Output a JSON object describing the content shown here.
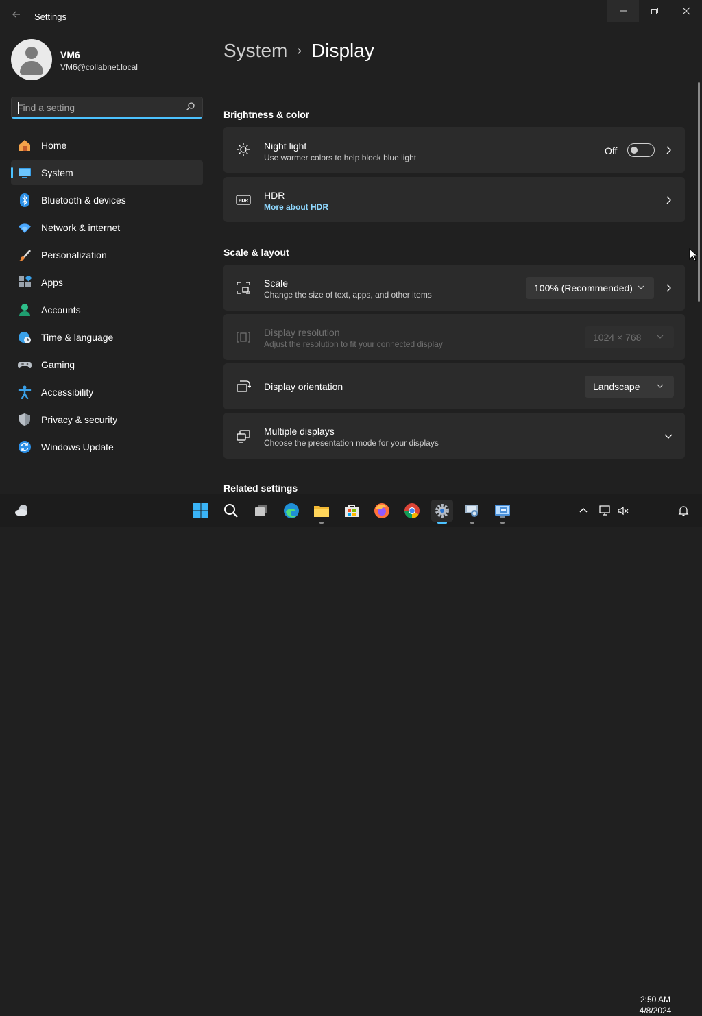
{
  "window": {
    "title": "Settings"
  },
  "user": {
    "name": "VM6",
    "email": "VM6@collabnet.local"
  },
  "search": {
    "placeholder": "Find a setting"
  },
  "sidebar": {
    "items": [
      {
        "label": "Home",
        "icon": "home-icon"
      },
      {
        "label": "System",
        "icon": "system-icon",
        "active": true
      },
      {
        "label": "Bluetooth & devices",
        "icon": "bluetooth-icon"
      },
      {
        "label": "Network & internet",
        "icon": "wifi-icon"
      },
      {
        "label": "Personalization",
        "icon": "brush-icon"
      },
      {
        "label": "Apps",
        "icon": "apps-icon"
      },
      {
        "label": "Accounts",
        "icon": "accounts-icon"
      },
      {
        "label": "Time & language",
        "icon": "globe-clock-icon"
      },
      {
        "label": "Gaming",
        "icon": "controller-icon"
      },
      {
        "label": "Accessibility",
        "icon": "accessibility-icon"
      },
      {
        "label": "Privacy & security",
        "icon": "shield-icon"
      },
      {
        "label": "Windows Update",
        "icon": "update-icon"
      }
    ]
  },
  "breadcrumb": {
    "parent": "System",
    "separator": "›",
    "current": "Display"
  },
  "sections": {
    "brightness": "Brightness & color",
    "scale": "Scale & layout",
    "related": "Related settings"
  },
  "cards": {
    "night_light": {
      "title": "Night light",
      "subtitle": "Use warmer colors to help block blue light",
      "state_label": "Off",
      "enabled": false
    },
    "hdr": {
      "title": "HDR",
      "link": "More about HDR"
    },
    "scale": {
      "title": "Scale",
      "subtitle": "Change the size of text, apps, and other items",
      "value": "100% (Recommended)"
    },
    "resolution": {
      "title": "Display resolution",
      "subtitle": "Adjust the resolution to fit your connected display",
      "value": "1024 × 768",
      "disabled": true
    },
    "orientation": {
      "title": "Display orientation",
      "value": "Landscape"
    },
    "multiple": {
      "title": "Multiple displays",
      "subtitle": "Choose the presentation mode for your displays"
    }
  },
  "taskbar": {
    "apps": [
      "weather-icon",
      "start-icon",
      "search-icon",
      "task-view-icon",
      "edge-icon",
      "file-explorer-icon",
      "store-icon",
      "firefox-icon",
      "chrome-icon",
      "settings-icon",
      "remote-desktop-icon",
      "rdp-icon"
    ],
    "time": "2:50 AM",
    "date": "4/8/2024"
  },
  "colors": {
    "accent": "#4cc2ff",
    "background": "#202020",
    "card": "#2b2b2b"
  }
}
